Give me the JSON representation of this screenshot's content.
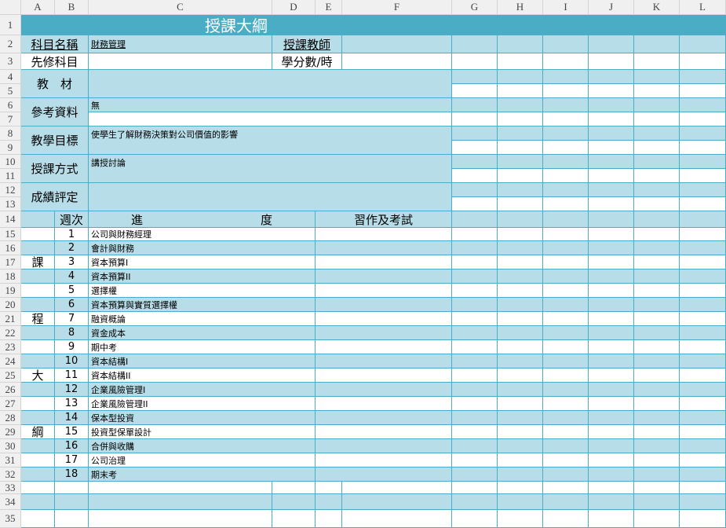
{
  "columns": [
    "A",
    "B",
    "C",
    "D",
    "E",
    "F",
    "G",
    "H",
    "I",
    "J",
    "K",
    "L"
  ],
  "row_numbers": [
    "1",
    "2",
    "3",
    "4",
    "5",
    "6",
    "7",
    "8",
    "9",
    "10",
    "11",
    "12",
    "13",
    "14",
    "15",
    "16",
    "17",
    "18",
    "19",
    "20",
    "21",
    "22",
    "23",
    "24",
    "25",
    "26",
    "27",
    "28",
    "29",
    "30",
    "31",
    "32",
    "33",
    "34",
    "35"
  ],
  "title": "授課大綱",
  "info": {
    "subject_label": "科目名稱",
    "subject_value": "財務管理",
    "teacher_label": "授課教師",
    "prereq_label": "先修科目",
    "credits_label": "學分數/時",
    "textbook_label": "教　材",
    "reference_label": "參考資料",
    "reference_value": "無",
    "objective_label": "教學目標",
    "objective_value": "使學生了解財務決策對公司價值的影響",
    "method_label": "授課方式",
    "method_value": "講授討論",
    "grading_label": "成績評定"
  },
  "schedule": {
    "week_header": "週次",
    "progress_header": "進　　　　　　　　　　度",
    "homework_header": "習作及考試",
    "side_chars": [
      "課",
      "程",
      "大",
      "綱"
    ],
    "rows": [
      {
        "week": "1",
        "topic": "公司與財務經理"
      },
      {
        "week": "2",
        "topic": "會計與財務"
      },
      {
        "week": "3",
        "topic": "資本預算Ⅰ"
      },
      {
        "week": "4",
        "topic": "資本預算II"
      },
      {
        "week": "5",
        "topic": "選擇權"
      },
      {
        "week": "6",
        "topic": "資本預算與實質選擇權"
      },
      {
        "week": "7",
        "topic": "融資概論"
      },
      {
        "week": "8",
        "topic": "資金成本"
      },
      {
        "week": "9",
        "topic": "期中考"
      },
      {
        "week": "10",
        "topic": "資本結構Ⅰ"
      },
      {
        "week": "11",
        "topic": "資本結構II"
      },
      {
        "week": "12",
        "topic": "企業風險管理Ⅰ"
      },
      {
        "week": "13",
        "topic": "企業風險管理II"
      },
      {
        "week": "14",
        "topic": "保本型投資"
      },
      {
        "week": "15",
        "topic": "投資型保單設計"
      },
      {
        "week": "16",
        "topic": "合併與收購"
      },
      {
        "week": "17",
        "topic": "公司治理"
      },
      {
        "week": "18",
        "topic": "期末考"
      }
    ]
  },
  "colors": {
    "header": "#4BACC6",
    "band": "#B7DDE8"
  }
}
